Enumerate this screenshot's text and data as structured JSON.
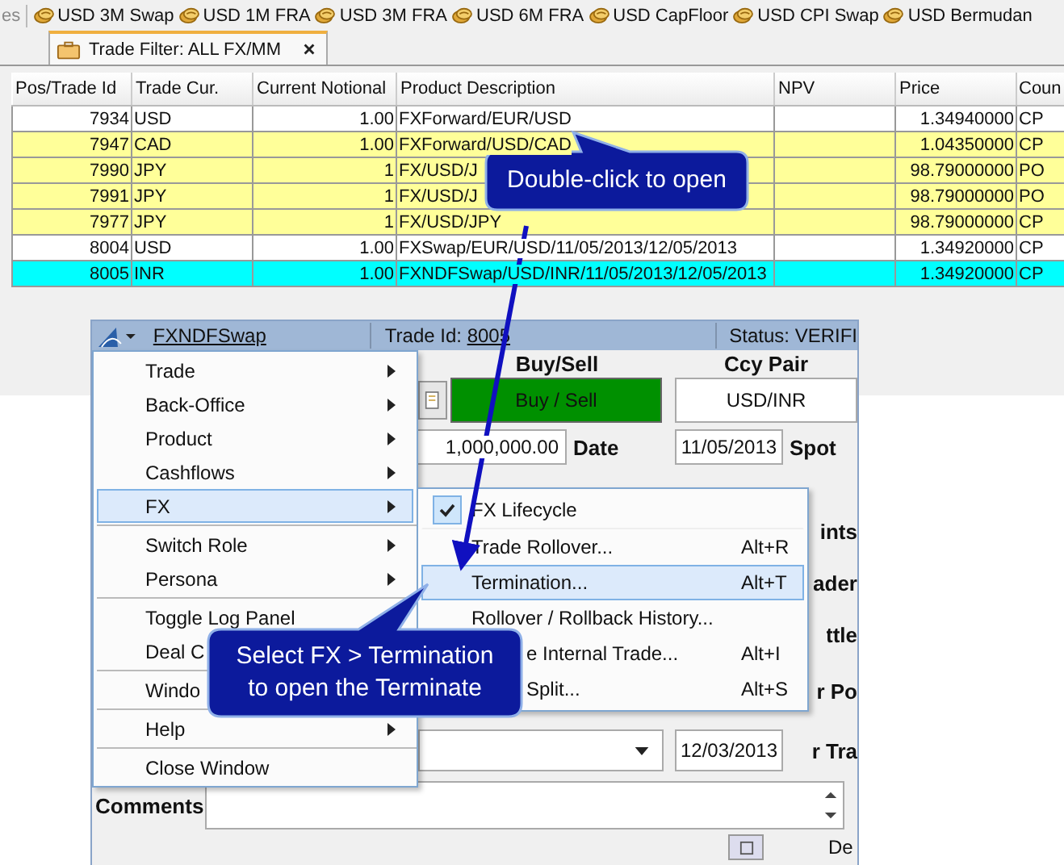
{
  "toolbar": {
    "cut_label": "es",
    "items": [
      "USD 3M Swap",
      "USD 1M FRA",
      "USD 3M FRA",
      "USD 6M FRA",
      "USD CapFloor",
      "USD CPI Swap",
      "USD Bermudan"
    ]
  },
  "tab": {
    "label": "Trade Filter: ALL FX/MM"
  },
  "table": {
    "columns": [
      "Pos/Trade Id",
      "Trade Cur.",
      "Current Notional",
      "Product Description",
      "NPV",
      "Price",
      "Coun"
    ],
    "rows": [
      {
        "cells": [
          "7934",
          "USD",
          "1.00",
          "FXForward/EUR/USD",
          "",
          "1.34940000",
          "CP"
        ],
        "color": "#ffffff"
      },
      {
        "cells": [
          "7947",
          "CAD",
          "1.00",
          "FXForward/USD/CAD",
          "",
          "1.04350000",
          "CP"
        ],
        "color": "#ffff99"
      },
      {
        "cells": [
          "7990",
          "JPY",
          "1",
          "FX/USD/J",
          "",
          "98.79000000",
          "PO"
        ],
        "color": "#ffff99"
      },
      {
        "cells": [
          "7991",
          "JPY",
          "1",
          "FX/USD/J",
          "",
          "98.79000000",
          "PO"
        ],
        "color": "#ffff99"
      },
      {
        "cells": [
          "7977",
          "JPY",
          "1",
          "FX/USD/JPY",
          "",
          "98.79000000",
          "CP"
        ],
        "color": "#ffff99"
      },
      {
        "cells": [
          "8004",
          "USD",
          "1.00",
          "FXSwap/EUR/USD/11/05/2013/12/05/2013",
          "",
          "1.34920000",
          "CP"
        ],
        "color": "#ffffff"
      },
      {
        "cells": [
          "8005",
          "INR",
          "1.00",
          "FXNDFSwap/USD/INR/11/05/2013/12/05/2013",
          "",
          "1.34920000",
          "CP"
        ],
        "color": "#00ffff"
      }
    ]
  },
  "window": {
    "title": "FXNDFSwap",
    "trade_id_label": "Trade Id:",
    "trade_id": "8005",
    "status": "Status: VERIFI",
    "buy_sell_label": "Buy/Sell",
    "buy_sell_button": "Buy / Sell",
    "ccy_pair_label": "Ccy Pair",
    "ccy_pair": "USD/INR",
    "amount": "1,000,000.00",
    "date_label": "Date",
    "date": "11/05/2013",
    "spot_label": "Spot",
    "cut_labels": [
      "ints",
      "ader",
      "ttle",
      "r Po",
      "r Tra"
    ],
    "end_date": "12/03/2013",
    "comments_label": "Comments",
    "bottom_cut_label": "De"
  },
  "context_menu": {
    "items": [
      {
        "kind": "item",
        "label": "Trade",
        "submenu": true,
        "selected": false
      },
      {
        "kind": "item",
        "label": "Back-Office",
        "submenu": true,
        "selected": false
      },
      {
        "kind": "item",
        "label": "Product",
        "submenu": true,
        "selected": false
      },
      {
        "kind": "item",
        "label": "Cashflows",
        "submenu": true,
        "selected": false
      },
      {
        "kind": "item",
        "label": "FX",
        "submenu": true,
        "selected": true
      },
      {
        "kind": "separator"
      },
      {
        "kind": "item",
        "label": "Switch Role",
        "submenu": true,
        "selected": false
      },
      {
        "kind": "item",
        "label": "Persona",
        "submenu": true,
        "selected": false
      },
      {
        "kind": "separator"
      },
      {
        "kind": "item",
        "label": "Toggle Log Panel",
        "selected": false
      },
      {
        "kind": "item",
        "label": "Deal C",
        "selected": false
      },
      {
        "kind": "separator"
      },
      {
        "kind": "item",
        "label": "Windo",
        "selected": false
      },
      {
        "kind": "separator"
      },
      {
        "kind": "item",
        "label": "Help",
        "submenu": true,
        "selected": false
      },
      {
        "kind": "separator"
      },
      {
        "kind": "item",
        "label": "Close Window",
        "submenu": false,
        "selected": false
      }
    ]
  },
  "submenu": {
    "items": [
      {
        "label": "FX Lifecycle",
        "checked": true,
        "selected": false
      },
      {
        "label": "Trade Rollover...",
        "shortcut": "Alt+R",
        "checked": false,
        "selected": false
      },
      {
        "label": "Termination...",
        "shortcut": "Alt+T",
        "checked": false,
        "selected": true
      },
      {
        "label": "Rollover / Rollback History...",
        "checked": false,
        "selected": false
      },
      {
        "label": "e Internal Trade...",
        "shortcut": "Alt+I",
        "selected": false
      },
      {
        "label": "Split...",
        "shortcut": "Alt+S",
        "selected": false
      }
    ]
  },
  "callouts": [
    {
      "lines": [
        "Double-click to open"
      ]
    },
    {
      "lines": [
        "Select FX > Termination",
        "to open the Terminate"
      ]
    }
  ]
}
